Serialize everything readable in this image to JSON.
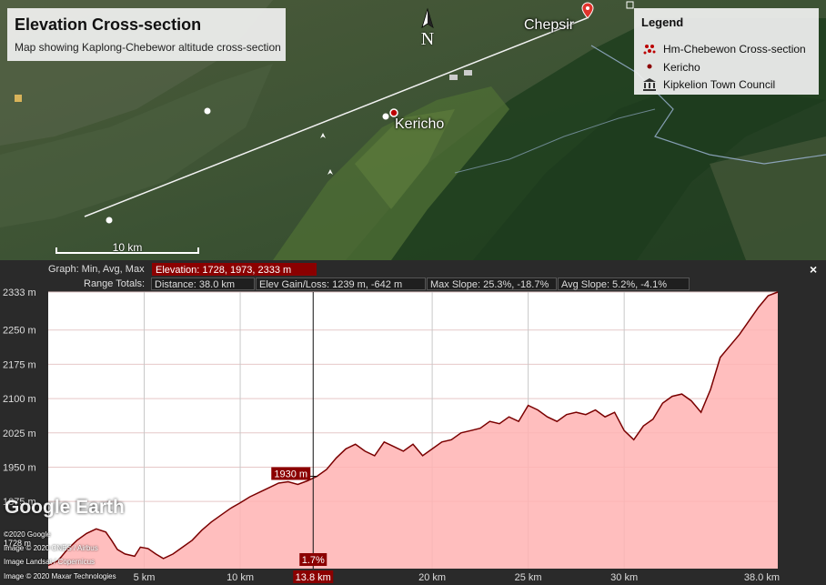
{
  "map": {
    "title": "Elevation Cross-section",
    "subtitle": "Map showing Kaplong-Chebewor altitude cross-section",
    "place_labels": [
      "Chepsir",
      "Kericho"
    ],
    "north_label": "N",
    "scale_label": "10 km",
    "legend": {
      "title": "Legend",
      "items": [
        {
          "label": "Hm-Chebewon Cross-section",
          "icon": "dots-icon"
        },
        {
          "label": "Kericho",
          "icon": "point-icon"
        },
        {
          "label": "Kipkelion Town Council",
          "icon": "building-icon"
        }
      ]
    }
  },
  "profile": {
    "graph_label": "Graph: Min, Avg, Max",
    "elevation_stat": "Elevation: 1728, 1973, 2333 m",
    "range_label": "Range Totals:",
    "distance_stat": "Distance: 38.0 km",
    "gain_stat": "Elev Gain/Loss: 1239 m, -642 m",
    "max_slope_stat": "Max Slope: 25.3%, -18.7%",
    "avg_slope_stat": "Avg Slope: 5.2%, -4.1%",
    "close_label": "×",
    "cursor_elev_label": "1930 m",
    "cursor_slope_label": "1.7%",
    "cursor_km_label": "13.8 km",
    "logo_text": "Google Earth",
    "attributions": [
      "©2020 Google",
      "Image © 2020 CNES / Airbus",
      "Image Landsat / Copernicus",
      "Image © 2020 Maxar Technologies"
    ],
    "min_label": "1728 m",
    "colors": {
      "fill": "#ffb3b3",
      "line": "#7a0000",
      "accent": "#8b0000"
    }
  },
  "chart_data": {
    "type": "area",
    "title": "",
    "xlabel": "",
    "ylabel": "",
    "xlim": [
      0,
      38.0
    ],
    "ylim": [
      1728,
      2333
    ],
    "y_ticks": [
      "2333 m",
      "2250 m",
      "2175 m",
      "2100 m",
      "2025 m",
      "1950 m",
      "1875 m"
    ],
    "y_tick_values": [
      2333,
      2250,
      2175,
      2100,
      2025,
      1950,
      1875
    ],
    "x_ticks": [
      "5 km",
      "10 km",
      "20 km",
      "25 km",
      "30 km",
      "38.0 km"
    ],
    "x_tick_values": [
      5,
      10,
      20,
      25,
      30,
      38
    ],
    "cursor": {
      "x": 13.8,
      "y": 1930
    },
    "series": [
      {
        "x": [
          0,
          0.5,
          1,
          1.5,
          2,
          2.5,
          3,
          3.3,
          3.6,
          4,
          4.5,
          4.8,
          5.2,
          5.6,
          6,
          6.5,
          7,
          7.5,
          8,
          8.5,
          9,
          9.5,
          10,
          10.5,
          11,
          11.5,
          12,
          12.5,
          13,
          13.5,
          14,
          14.5,
          15,
          15.5,
          16,
          16.5,
          17,
          17.5,
          18,
          18.5,
          19,
          19.5,
          20,
          20.5,
          21,
          21.5,
          22,
          22.5,
          23,
          23.5,
          24,
          24.5,
          25,
          25.5,
          26,
          26.5,
          27,
          27.5,
          28,
          28.5,
          29,
          29.5,
          30,
          30.5,
          31,
          31.5,
          32,
          32.5,
          33,
          33.5,
          34,
          34.5,
          35,
          35.5,
          36,
          36.5,
          37,
          37.5,
          38
        ],
        "y": [
          1735,
          1745,
          1770,
          1790,
          1805,
          1815,
          1808,
          1790,
          1770,
          1760,
          1755,
          1775,
          1772,
          1760,
          1750,
          1760,
          1775,
          1790,
          1812,
          1830,
          1845,
          1860,
          1872,
          1885,
          1895,
          1905,
          1915,
          1918,
          1912,
          1920,
          1930,
          1945,
          1970,
          1990,
          2000,
          1985,
          1975,
          2005,
          1995,
          1985,
          2000,
          1975,
          1990,
          2005,
          2010,
          2025,
          2030,
          2035,
          2050,
          2045,
          2060,
          2050,
          2085,
          2075,
          2060,
          2050,
          2065,
          2070,
          2065,
          2075,
          2060,
          2070,
          2030,
          2010,
          2040,
          2055,
          2090,
          2105,
          2110,
          2095,
          2070,
          2120,
          2190,
          2215,
          2240,
          2270,
          2300,
          2325,
          2333
        ]
      }
    ]
  }
}
